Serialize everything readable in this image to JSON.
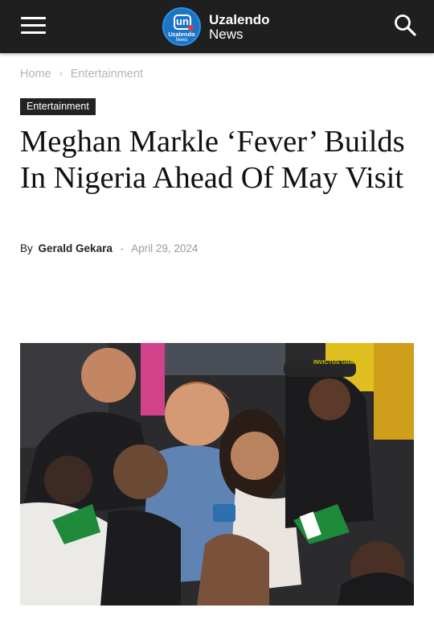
{
  "header": {
    "logo_mark": "un",
    "logo_badge_line1": "Uzalendo",
    "logo_badge_line2": "News",
    "logo_name": "Uzalendo",
    "logo_sub": "News"
  },
  "breadcrumb": {
    "home": "Home",
    "separator": "›",
    "section": "Entertainment"
  },
  "article": {
    "category": "Entertainment",
    "title": "Meghan Markle ‘Fever’ Builds In Nigeria Ahead Of May Visit",
    "by_label": "By",
    "author": "Gerald Gekara",
    "separator": "-",
    "date": "April 29, 2024"
  },
  "photo": {
    "sign_text": "INVICTUS GAMES"
  },
  "colors": {
    "topbar": "#1f1f1f",
    "logo_blue": "#1b74c6",
    "tag_bg": "#222222",
    "breadcrumb": "#b5b5b5"
  },
  "icons": {
    "menu": "hamburger-menu-icon",
    "search": "search-icon"
  }
}
